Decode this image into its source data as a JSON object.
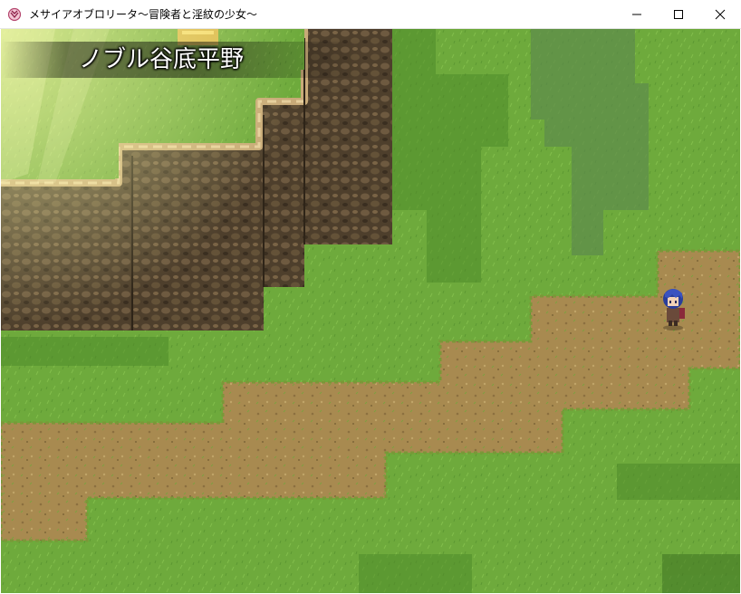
{
  "window": {
    "title": "メサイアオブロリータ～冒険者と淫紋の少女～",
    "icon": "pink-emblem-icon",
    "controls": {
      "minimize": "minimize-icon",
      "maximize": "maximize-icon",
      "close": "close-icon"
    }
  },
  "game": {
    "map_name": "ノブル谷底平野",
    "colors": {
      "grass": "#6eaa3c",
      "grass_dark": "#4f8a2a",
      "dirt": "#a88a50",
      "rock": "#5a4a34",
      "rock_top": "#c8aa78"
    }
  }
}
